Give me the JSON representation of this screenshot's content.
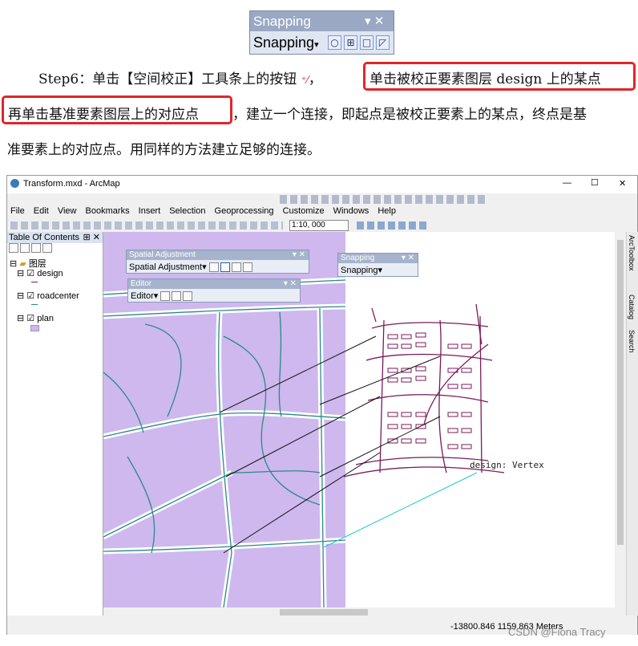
{
  "snapping_toolbar": {
    "title": "Snapping",
    "title_controls": "▾ ✕",
    "dropdown_label": "Snapping",
    "dropdown_arrow": "▾",
    "icons": [
      "point-snap-icon",
      "end-snap-icon",
      "vertex-snap-icon",
      "edge-snap-icon"
    ]
  },
  "paragraph": {
    "line1_lead": "Step6：单击【空间校正】工具条上的按钮",
    "line1_sep": "，",
    "line1_boxed": "单击被校正要素图层 design 上的某点",
    "line2_boxed": "再单击基准要素图层上的对应点",
    "line2_rest": "，建立一个连接，即起点是被校正要素上的某点，终点是基",
    "line3": "准要素上的对应点。用同样的方法建立足够的连接。"
  },
  "window": {
    "title": "Transform.mxd - ArcMap",
    "min_btn": "—",
    "max_btn": "☐",
    "close_btn": "✕",
    "menu": [
      "File",
      "Edit",
      "View",
      "Bookmarks",
      "Insert",
      "Selection",
      "Geoprocessing",
      "Customize",
      "Windows",
      "Help"
    ],
    "scale": "1:10, 000"
  },
  "toc": {
    "title": "Table Of Contents",
    "pin": "⊞ ✕",
    "group": "图层",
    "layers": [
      {
        "name": "design"
      },
      {
        "name": "roadcenter"
      },
      {
        "name": "plan"
      }
    ]
  },
  "spatial_adjustment": {
    "title": "Spatial Adjustment",
    "dropdown": "Spatial Adjustment",
    "title_controls": "▾ ✕"
  },
  "editor": {
    "title": "Editor",
    "dropdown": "Editor",
    "title_controls": "▾ ✕"
  },
  "snapping_small": {
    "title": "Snapping",
    "dropdown": "Snapping",
    "title_controls": "▾ ✕"
  },
  "map": {
    "annotation": "design: Vertex"
  },
  "right_tabs": [
    "ArcToolbox",
    "Catalog",
    "Search"
  ],
  "status": {
    "coords": "-13800.846  1159.863 Meters"
  },
  "watermark": "CSDN @Fiona Tracy",
  "colors": {
    "plan_fill": "#ceb8ee",
    "road": "#2a8a8a",
    "design": "#7a1a5a",
    "link": "#111111",
    "cyan_link": "#1ec8d8",
    "highlight": "#e0262a"
  }
}
